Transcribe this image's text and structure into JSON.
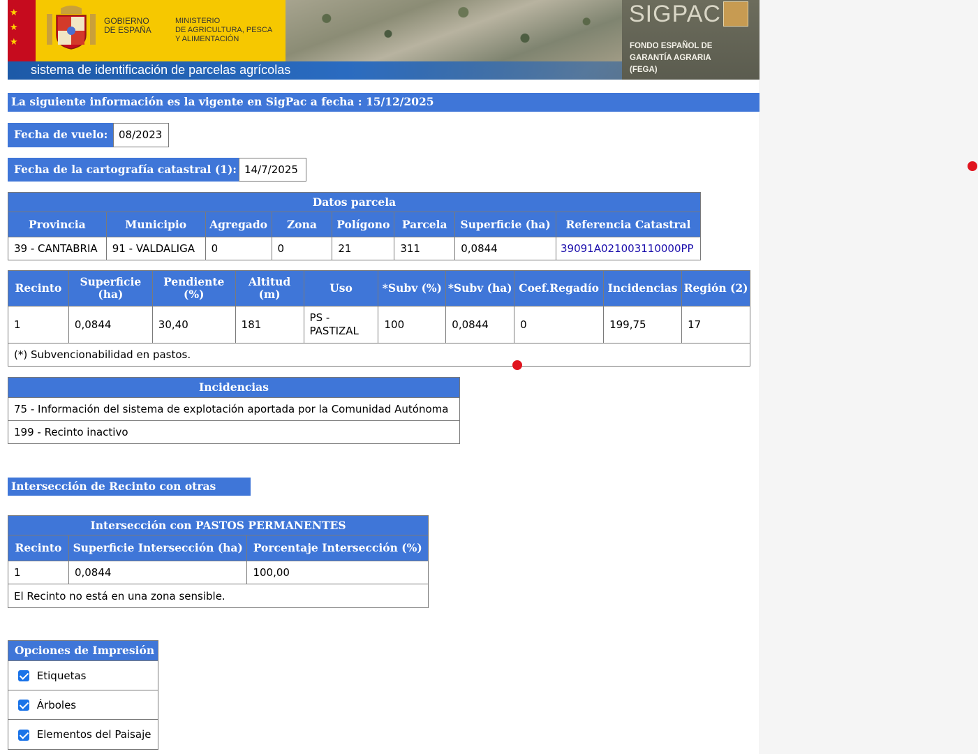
{
  "header": {
    "gov_line1": "GOBIERNO",
    "gov_line2": "DE ESPAÑA",
    "ministry_line1": "MINISTERIO",
    "ministry_line2": "DE AGRICULTURA, PESCA",
    "ministry_line3": "Y ALIMENTACIÓN",
    "app_name": "SIGPAC",
    "fega_line1": "FONDO ESPAÑOL DE",
    "fega_line2": "GARANTÍA AGRARIA",
    "fega_line3": "(FEGA)",
    "subtitle": "sistema de identificación de parcelas agrícolas"
  },
  "info_date_text": "La siguiente información es la vigente en SigPac a fecha : 15/12/2025",
  "vuelo": {
    "label": "Fecha de vuelo:",
    "value": "08/2023"
  },
  "cartografia": {
    "label": "Fecha de la cartografía catastral (1):",
    "value": "14/7/2025"
  },
  "datos_parcela": {
    "title": "Datos parcela",
    "headers": [
      "Provincia",
      "Municipio",
      "Agregado",
      "Zona",
      "Polígono",
      "Parcela",
      "Superficie (ha)",
      "Referencia Catastral"
    ],
    "row": [
      "39 - CANTABRIA",
      "91 - VALDALIGA",
      "0",
      "0",
      "21",
      "311",
      "0,0844",
      "39091A021003110000PP"
    ]
  },
  "recinto": {
    "headers": [
      "Recinto",
      "Superficie (ha)",
      "Pendiente (%)",
      "Altitud (m)",
      "Uso",
      "*Subv (%)",
      "*Subv (ha)",
      "Coef.Regadío",
      "Incidencias",
      "Región (2)"
    ],
    "row": [
      "1",
      "0,0844",
      "30,40",
      "181",
      "PS - PASTIZAL",
      "100",
      "0,0844",
      "0",
      "199,75",
      "17"
    ],
    "note": "(*) Subvencionabilidad en pastos."
  },
  "incidencias": {
    "title": "Incidencias",
    "items": [
      "75 - Información del sistema de explotación aportada por la Comunidad Autónoma",
      "199 - Recinto inactivo"
    ]
  },
  "interseccion_title": "Intersección de Recinto con otras capas",
  "pastos": {
    "title": "Intersección con PASTOS PERMANENTES",
    "headers": [
      "Recinto",
      "Superficie Intersección (ha)",
      "Porcentaje Intersección (%)"
    ],
    "row": [
      "1",
      "0,0844",
      "100,00"
    ],
    "note": "El Recinto no está en una zona sensible."
  },
  "impresion": {
    "title": "Opciones de Impresión",
    "options": [
      "Etiquetas",
      "Árboles",
      "Elementos del Paisaje"
    ]
  },
  "colors": {
    "header_blue": "#3f76d8",
    "marker_red": "#e0141e",
    "link": "#1a0dab"
  }
}
